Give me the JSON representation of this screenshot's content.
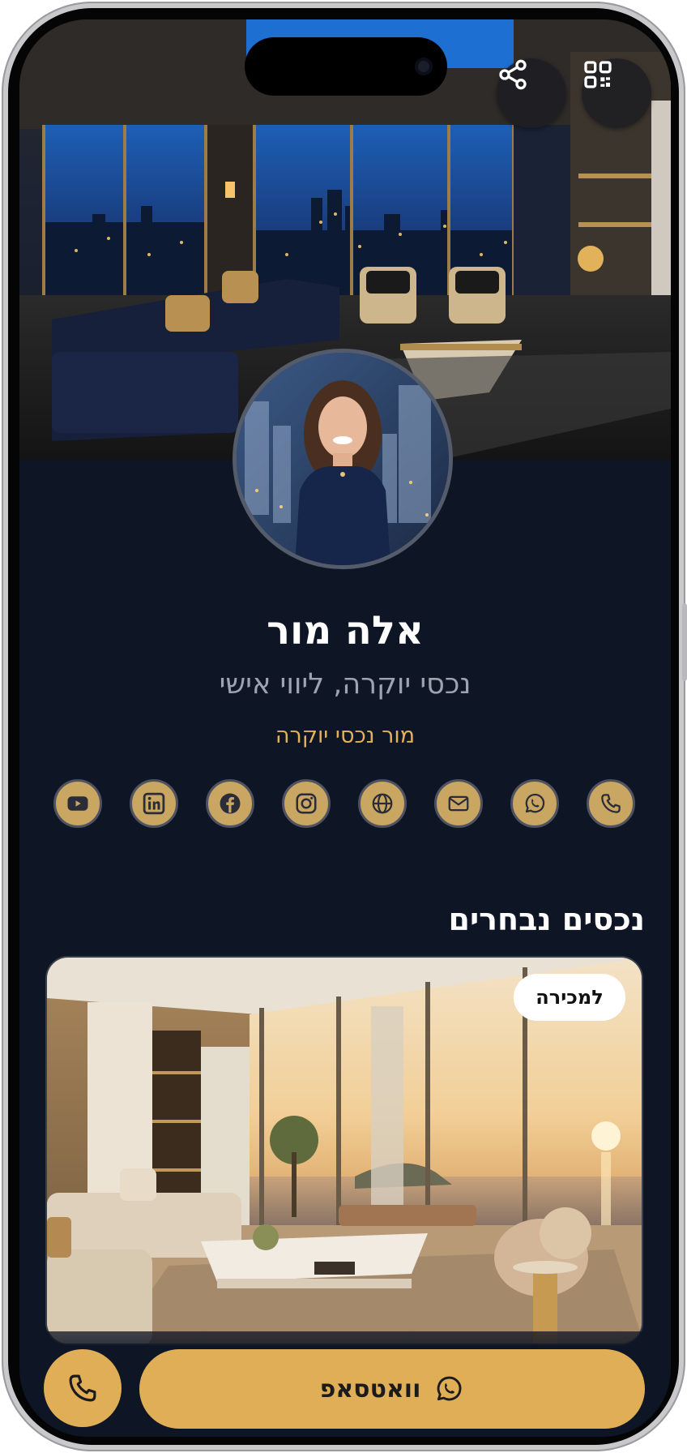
{
  "profile": {
    "name": "אלה מור",
    "subtitle": "נכסי יוקרה, ליווי אישי",
    "company": "מור נכסי יוקרה"
  },
  "header": {
    "share_icon": "share-icon",
    "qr_icon": "qr-code-icon"
  },
  "social_links": [
    {
      "icon": "youtube-icon"
    },
    {
      "icon": "linkedin-icon"
    },
    {
      "icon": "facebook-icon"
    },
    {
      "icon": "instagram-icon"
    },
    {
      "icon": "globe-icon"
    },
    {
      "icon": "mail-icon"
    },
    {
      "icon": "whatsapp-icon"
    },
    {
      "icon": "phone-icon"
    }
  ],
  "properties": {
    "title": "נכסים נבחרים",
    "items": [
      {
        "badge": "למכירה"
      }
    ]
  },
  "actions": {
    "whatsapp_label": "וואטסאפ",
    "call_icon": "phone-icon"
  },
  "colors": {
    "background": "#0e1524",
    "accent_gold": "#e0ae57",
    "text_muted": "#9da3b0"
  }
}
